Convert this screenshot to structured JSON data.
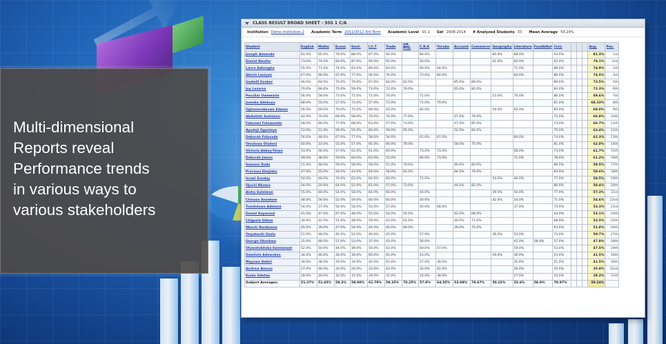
{
  "headline": "Multi-dimensional\nReports reveal\nPerformance trends\nin various ways to\nvarious stakeholders",
  "report": {
    "title": "CLASS RESULT BROAD SHEET - SSS 1 C/A",
    "filters": [
      {
        "label": "Institution",
        "value": "Demo Institution 2",
        "link": true
      },
      {
        "label": "Academic Term",
        "value": "2011/2012 3rd Term",
        "link": true
      },
      {
        "label": "Academic Level",
        "value": "SS 1",
        "link": false
      },
      {
        "label": "Set",
        "value": "2008-2014",
        "link": false
      },
      {
        "label": "# Analyzed Students",
        "value": "33",
        "link": false
      },
      {
        "label": "Mean Average",
        "value": "59.24%",
        "link": false
      }
    ],
    "columns": [
      "Student",
      "English",
      "Maths",
      "Econs",
      "Govt.",
      "I.C.T",
      "Trade",
      "Off. Prac",
      "C.R.K",
      "Yoruba",
      "Account",
      "Commerce",
      "Geography",
      "Literature",
      "Food&Nut",
      "Civic",
      "",
      "",
      "",
      "Avg.",
      "Pos."
    ],
    "rows": [
      [
        "Joseph Aimende",
        "81.0%",
        "65.0%",
        "79.0%",
        "88.0%",
        "87.0%",
        "94.0%",
        "",
        "84.0%",
        "",
        "",
        "",
        "84.0%",
        "68.0%",
        "",
        "93.0%",
        "",
        "",
        "",
        "81.3%",
        "1st"
      ],
      [
        "Daniel Nwafor",
        "73.0%",
        "74.0%",
        "83.0%",
        "87.0%",
        "94.0%",
        "91.0%",
        "",
        "56.0%",
        "",
        "",
        "",
        "61.0%",
        "60.0%",
        "",
        "92.0%",
        "",
        "",
        "",
        "78.1%",
        "2nd"
      ],
      [
        "Lanre Adesegha",
        "55.0%",
        "71.0%",
        "74.0%",
        "63.0%",
        "89.0%",
        "83.0%",
        "",
        "90.0%",
        "64.0%",
        "",
        "",
        "",
        "71.0%",
        "",
        "89.0%",
        "",
        "",
        "",
        "74.9%",
        "3rd"
      ],
      [
        "Abiola Laniyan",
        "67.0%",
        "69.0%",
        "67.0%",
        "77.0%",
        "56.0%",
        "76.0%",
        "",
        "73.0%",
        "80.0%",
        "",
        "",
        "",
        "64.0%",
        "",
        "80.0%",
        "",
        "",
        "",
        "74.5%",
        "3rd"
      ],
      [
        "Godwill Ozobor",
        "46.0%",
        "64.0%",
        "70.0%",
        "79.0%",
        "67.0%",
        "64.0%",
        "82.0%",
        "",
        "",
        "85.0%",
        "89.0%",
        "",
        "",
        "",
        "89.0%",
        "",
        "",
        "",
        "73.5%",
        "5th"
      ],
      [
        "Joy Lazarus",
        "70.0%",
        "66.0%",
        "75.0%",
        "59.0%",
        "73.0%",
        "72.0%",
        "76.0%",
        "",
        "",
        "65.0%",
        "82.0%",
        "",
        "",
        "",
        "83.0%",
        "",
        "",
        "",
        "72.3%",
        "6th"
      ],
      [
        "Peculiar Uwemarin",
        "56.0%",
        "58.0%",
        "73.0%",
        "71.0%",
        "72.0%",
        "70.0%",
        "",
        "71.0%",
        "",
        "",
        "",
        "53.0%",
        "70.0%",
        "",
        "86.0%",
        "",
        "",
        "",
        "69.6%",
        "7th"
      ],
      [
        "Jumoke Adekoya",
        "68.0%",
        "55.0%",
        "57.0%",
        "73.0%",
        "57.0%",
        "73.0%",
        "",
        "71.0%",
        "79.0%",
        "",
        "",
        "",
        "",
        "",
        "81.0%",
        "",
        "",
        "",
        "68.33%",
        "8th"
      ],
      [
        "Oghenerukevwe Edema",
        "56.0%",
        "69.0%",
        "70.0%",
        "75.0%",
        "69.0%",
        "45.0%",
        "",
        "82.0%",
        "",
        "",
        "",
        "54.0%",
        "65.0%",
        "",
        "85.0%",
        "",
        "",
        "",
        "68.0%",
        "9th"
      ],
      [
        "Abdullahi Suleiman",
        "42.0%",
        "70.0%",
        "69.0%",
        "58.0%",
        "70.0%",
        "74.0%",
        "77.0%",
        "",
        "",
        "57.0%",
        "79.0%",
        "",
        "",
        "",
        "72.0%",
        "",
        "",
        "",
        "66.8%",
        "10th"
      ],
      [
        "Fabunmi Folowosele",
        "58.0%",
        "66.0%",
        "77.0%",
        "68.0%",
        "63.0%",
        "57.0%",
        "73.0%",
        "",
        "",
        "47.0%",
        "85.0%",
        "",
        "",
        "",
        "73.0%",
        "",
        "",
        "",
        "66.7%",
        "11th"
      ],
      [
        "Ayodeji Ogunleye",
        "53.0%",
        "51.0%",
        "59.0%",
        "55.0%",
        "66.0%",
        "59.0%",
        "65.0%",
        "",
        "",
        "52.0%",
        "82.0%",
        "",
        "",
        "",
        "75.0%",
        "",
        "",
        "",
        "63.4%",
        "12th"
      ],
      [
        "Deborah Falusade",
        "56.0%",
        "48.0%",
        "67.0%",
        "77.0%",
        "58.0%",
        "54.0%",
        "",
        "61.0%",
        "67.0%",
        "",
        "",
        "",
        "60.0%",
        "",
        "74.0%",
        "",
        "",
        "",
        "62.3%",
        "13th"
      ],
      [
        "Omolowa Oladeni",
        "60.0%",
        "33.0%",
        "55.0%",
        "57.0%",
        "65.0%",
        "60.0%",
        "78.0%",
        "",
        "",
        "58.0%",
        "75.0%",
        "",
        "",
        "",
        "81.0%",
        "",
        "",
        "",
        "62.0%",
        "14th"
      ],
      [
        "Victoria Abbey-Taiwo",
        "53.0%",
        "56.0%",
        "57.0%",
        "61.0%",
        "61.0%",
        "60.0%",
        "",
        "73.0%",
        "73.0%",
        "",
        "",
        "",
        "58.0%",
        "",
        "73.0%",
        "",
        "",
        "",
        "61.7%",
        "15th"
      ],
      [
        "Deborah James",
        "49.0%",
        "38.0%",
        "59.0%",
        "60.0%",
        "63.0%",
        "55.0%",
        "",
        "66.0%",
        "73.0%",
        "",
        "",
        "",
        "71.0%",
        "",
        "78.0%",
        "",
        "",
        "",
        "61.2%",
        "16th"
      ],
      [
        "Samson Dada",
        "51.0%",
        "48.0%",
        "59.0%",
        "58.0%",
        "58.0%",
        "51.0%",
        "70.0%",
        "",
        "",
        "46.0%",
        "80.0%",
        "",
        "",
        "",
        "66.0%",
        "",
        "",
        "",
        "59.5%",
        "17th"
      ],
      [
        "Precious Ekejiaku",
        "47.0%",
        "55.0%",
        "50.0%",
        "43.0%",
        "64.0%",
        "58.0%",
        "65.0%",
        "",
        "",
        "64.0%",
        "76.0%",
        "",
        "",
        "",
        "64.0%",
        "",
        "",
        "",
        "58.6%",
        "18th"
      ],
      [
        "Israel Sunday",
        "54.0%",
        "46.0%",
        "70.0%",
        "63.0%",
        "64.0%",
        "60.0%",
        "",
        "71.0%",
        "",
        "",
        "",
        "54.0%",
        "46.0%",
        "",
        "77.0%",
        "",
        "",
        "",
        "58.5%",
        "19th"
      ],
      [
        "Ojochi Nkama",
        "54.0%",
        "20.0%",
        "64.0%",
        "51.0%",
        "61.0%",
        "57.0%",
        "73.0%",
        "",
        "",
        "44.0%",
        "82.0%",
        "",
        "",
        "",
        "80.0%",
        "",
        "",
        "",
        "58.4%",
        "20th"
      ],
      [
        "Aisha Suleiman",
        "55.0%",
        "60.0%",
        "54.0%",
        "58.0%",
        "64.0%",
        "66.0%",
        "",
        "44.0%",
        "",
        "",
        "",
        "39.0%",
        "50.0%",
        "",
        "77.0%",
        "",
        "",
        "",
        "57.3%",
        "21st"
      ],
      [
        "Chinaza Anaekwe",
        "48.0%",
        "56.0%",
        "52.0%",
        "59.0%",
        "60.0%",
        "60.0%",
        "",
        "40.0%",
        "",
        "",
        "",
        "42.0%",
        "54.0%",
        "",
        "71.0%",
        "",
        "",
        "",
        "54.6%",
        "22nd"
      ],
      [
        "Tomilolowa Adelona",
        "54.0%",
        "37.0%",
        "54.0%",
        "54.0%",
        "53.0%",
        "57.0%",
        "",
        "45.0%",
        "68.0%",
        "",
        "",
        "",
        "37.0%",
        "",
        "74.0%",
        "",
        "",
        "",
        "53.3%",
        "23rd"
      ],
      [
        "Daniel Raymond",
        "41.0%",
        "47.0%",
        "67.0%",
        "48.0%",
        "55.0%",
        "54.0%",
        "55.0%",
        "",
        "",
        "42.0%",
        "68.0%",
        "",
        "",
        "",
        "44.0%",
        "",
        "",
        "",
        "53.1%",
        "24th"
      ],
      [
        "Chigozie Udeze",
        "30.0%",
        "42.0%",
        "51.0%",
        "48.0%",
        "59.0%",
        "42.0%",
        "61.0%",
        "",
        "",
        "40.0%",
        "71.0%",
        "",
        "",
        "",
        "68.0%",
        "",
        "",
        "",
        "52.5%",
        "25th"
      ],
      [
        "Nkechi Nwabueze",
        "45.0%",
        "39.0%",
        "47.0%",
        "54.0%",
        "44.0%",
        "46.0%",
        "66.0%",
        "",
        "",
        "39.0%",
        "75.0%",
        "",
        "",
        "",
        "63.0%",
        "",
        "",
        "",
        "51.8%",
        "26th"
      ],
      [
        "Onyekachi Uzulu",
        "51.0%",
        "48.0%",
        "45.0%",
        "52.0%",
        "46.0%",
        "45.0%",
        "",
        "57.0%",
        "",
        "",
        "",
        "36.0%",
        "53.0%",
        "",
        "73.0%",
        "",
        "",
        "",
        "50.7%",
        "27th"
      ],
      [
        "George Okonkwo",
        "31.0%",
        "48.0%",
        "57.0%",
        "53.0%",
        "37.0%",
        "45.0%",
        "",
        "56.0%",
        "",
        "",
        "",
        "",
        "42.0%",
        "58.0%",
        "57.0%",
        "",
        "",
        "",
        "47.8%",
        "28th"
      ],
      [
        "Oluwatobiloba Ewenanuel",
        "52.0%",
        "50.0%",
        "44.0%",
        "39.0%",
        "50.0%",
        "43.0%",
        "",
        "40.0%",
        "47.0%",
        "",
        "",
        "",
        "59.0%",
        "",
        "53.0%",
        "",
        "",
        "",
        "47.5%",
        "29th"
      ],
      [
        "Damilola Adewoken",
        "34.0%",
        "46.0%",
        "30.0%",
        "39.0%",
        "60.0%",
        "45.0%",
        "",
        "43.0%",
        "",
        "",
        "",
        "29.0%",
        "36.0%",
        "",
        "53.0%",
        "",
        "",
        "",
        "41.5%",
        "30th"
      ],
      [
        "Mayowa Debiri",
        "34.0%",
        "38.0%",
        "29.0%",
        "34.0%",
        "42.0%",
        "61.0%",
        "",
        "27.0%",
        "39.0%",
        "",
        "",
        "",
        "35.0%",
        "",
        "51.0%",
        "",
        "",
        "",
        "41.5%",
        "30th"
      ],
      [
        "Andrew Amosu",
        "27.0%",
        "46.0%",
        "20.0%",
        "26.0%",
        "33.0%",
        "42.0%",
        "",
        "32.0%",
        "42.0%",
        "",
        "",
        "",
        "26.0%",
        "",
        "35.0%",
        "",
        "",
        "",
        "35.9%",
        "32nd"
      ],
      [
        "Kunle Odetan",
        "28.0%",
        "20.0%",
        "32.0%",
        "31.0%",
        "29.0%",
        "31.0%",
        "",
        "24.0%",
        "38.0%",
        "",
        "",
        "",
        "27.0%",
        "",
        "33.0%",
        "",
        "",
        "",
        "29.3%",
        "33rd"
      ]
    ],
    "footer": [
      "Subject Averages:",
      "51.27%",
      "51.45%",
      "58.3%",
      "58.00%",
      "61.79%",
      "59.35%",
      "70.25%",
      "57.9%",
      "64.55%",
      "53.08%",
      "78.67%",
      "50.22%",
      "52.6%",
      "58.0%",
      "70.97%",
      "",
      "",
      "",
      "59.24%",
      ""
    ]
  }
}
